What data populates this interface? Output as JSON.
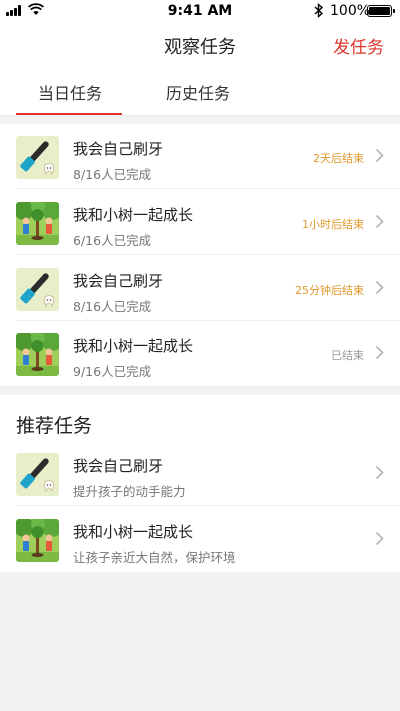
{
  "status_bar": {
    "time": "9:41 AM",
    "battery": "100%"
  },
  "nav": {
    "title": "观察任务",
    "action": "发任务"
  },
  "tabs": [
    {
      "label": "当日任务",
      "active": true
    },
    {
      "label": "历史任务",
      "active": false
    }
  ],
  "today_tasks": [
    {
      "title": "我会自己刷牙",
      "progress": "8/16人已完成",
      "status": "2天后结束",
      "icon": "toothbrush-icon"
    },
    {
      "title": "我和小树一起成长",
      "progress": "6/16人已完成",
      "status": "1小时后结束",
      "icon": "kids-tree-icon"
    },
    {
      "title": "我会自己刷牙",
      "progress": "8/16人已完成",
      "status": "25分钟后结束",
      "icon": "toothbrush-icon"
    },
    {
      "title": "我和小树一起成长",
      "progress": "9/16人已完成",
      "status": "已结束",
      "icon": "kids-tree-icon"
    }
  ],
  "recommended": {
    "heading": "推荐任务",
    "items": [
      {
        "title": "我会自己刷牙",
        "desc": "提升孩子的动手能力",
        "icon": "toothbrush-icon"
      },
      {
        "title": "我和小树一起成长",
        "desc": "让孩子亲近大自然，保护环境",
        "icon": "kids-tree-icon"
      }
    ]
  },
  "colors": {
    "accent": "#e0352b",
    "pending": "#e0982b",
    "ended": "#999999"
  }
}
